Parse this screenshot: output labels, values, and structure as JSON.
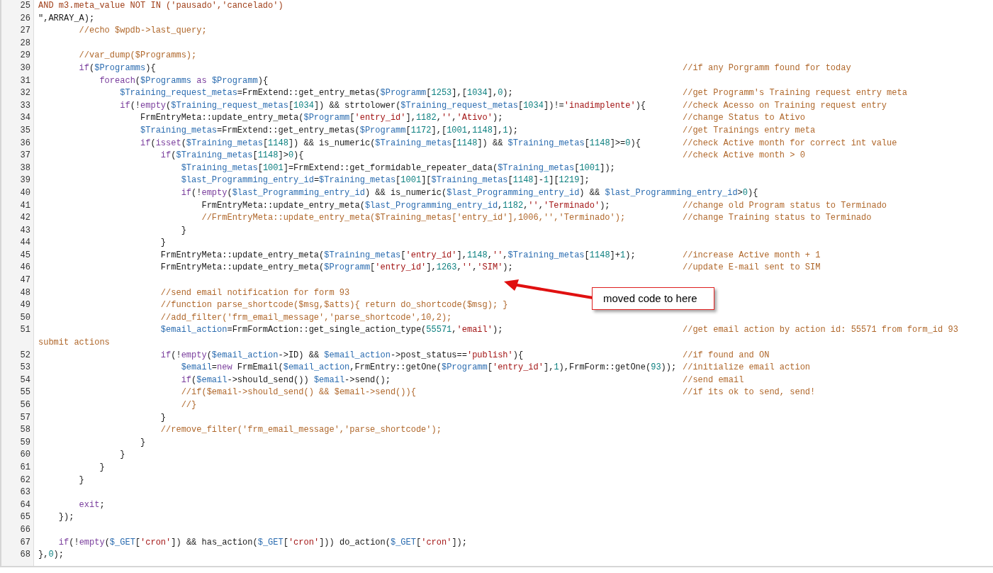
{
  "editor": {
    "lines": [
      {
        "number": "25",
        "kind": "string",
        "code": "AND m3.meta_value NOT IN ('pausado','cancelado')"
      },
      {
        "number": "26",
        "kind": "code",
        "code": "\",ARRAY_A);"
      },
      {
        "number": "27",
        "kind": "code",
        "code": "        //echo $wpdb->last_query;"
      },
      {
        "number": "28"
      },
      {
        "number": "29",
        "kind": "code",
        "code": "        //var_dump($Programms);"
      },
      {
        "number": "30",
        "kind": "code",
        "code": "        if($Programms){",
        "comment": "//if any Porgramm found for today"
      },
      {
        "number": "31",
        "kind": "code",
        "code": "            foreach($Programms as $Programm){"
      },
      {
        "number": "32",
        "kind": "code",
        "code": "                $Training_request_metas=FrmExtend::get_entry_metas($Programm[1253],[1034],0);",
        "comment": "//get Programm's Training request entry meta"
      },
      {
        "number": "33",
        "kind": "code",
        "code": "                if(!empty($Training_request_metas[1034]) && strtolower($Training_request_metas[1034])!='inadimplente'){",
        "comment": "//check Acesso on Training request entry"
      },
      {
        "number": "34",
        "kind": "code",
        "code": "                    FrmEntryMeta::update_entry_meta($Programm['entry_id'],1182,'','Ativo');",
        "comment": "//change Status to Ativo"
      },
      {
        "number": "35",
        "kind": "code",
        "code": "                    $Training_metas=FrmExtend::get_entry_metas($Programm[1172],[1001,1148],1);",
        "comment": "//get Trainings entry meta"
      },
      {
        "number": "36",
        "kind": "code",
        "code": "                    if(isset($Training_metas[1148]) && is_numeric($Training_metas[1148]) && $Training_metas[1148]>=0){",
        "comment": "//check Active month for correct int value"
      },
      {
        "number": "37",
        "kind": "code",
        "code": "                        if($Training_metas[1148]>0){",
        "comment": "//check Active month > 0"
      },
      {
        "number": "38",
        "kind": "code",
        "code": "                            $Training_metas[1001]=FrmExtend::get_formidable_repeater_data($Training_metas[1001]);"
      },
      {
        "number": "39",
        "kind": "code",
        "code": "                            $last_Programming_entry_id=$Training_metas[1001][$Training_metas[1148]-1][1219];"
      },
      {
        "number": "40",
        "kind": "code",
        "code": "                            if(!empty($last_Programming_entry_id) && is_numeric($last_Programming_entry_id) && $last_Programming_entry_id>0){"
      },
      {
        "number": "41",
        "kind": "code",
        "code": "                                FrmEntryMeta::update_entry_meta($last_Programming_entry_id,1182,'','Terminado');",
        "comment": "//change old Program status to Terminado"
      },
      {
        "number": "42",
        "kind": "code",
        "code": "                                //FrmEntryMeta::update_entry_meta($Training_metas['entry_id'],1006,'','Terminado');",
        "comment": "//change Training status to Terminado"
      },
      {
        "number": "43",
        "kind": "code",
        "code": "                            }"
      },
      {
        "number": "44",
        "kind": "code",
        "code": "                        }"
      },
      {
        "number": "45",
        "kind": "code",
        "code": "                        FrmEntryMeta::update_entry_meta($Training_metas['entry_id'],1148,'',$Training_metas[1148]+1);",
        "comment": "//increase Active month + 1"
      },
      {
        "number": "46",
        "kind": "code",
        "code": "                        FrmEntryMeta::update_entry_meta($Programm['entry_id'],1263,'','SIM');",
        "comment": "//update E-mail sent to SIM"
      },
      {
        "number": "47"
      },
      {
        "number": "48",
        "kind": "code",
        "code": "                        //send email notification for form 93"
      },
      {
        "number": "49",
        "kind": "code",
        "code": "                        //function parse_shortcode($msg,$atts){ return do_shortcode($msg); }"
      },
      {
        "number": "50",
        "kind": "code",
        "code": "                        //add_filter('frm_email_message','parse_shortcode',10,2);"
      },
      {
        "number": "51",
        "kind": "code",
        "code": "                        $email_action=FrmFormAction::get_single_action_type(55571,'email');",
        "comment": "//get email action by action id: 55571 from form_id 93",
        "comment_wrap": "submit actions"
      },
      {
        "number": "52",
        "kind": "code",
        "code": "                        if(!empty($email_action->ID) && $email_action->post_status=='publish'){",
        "comment": "//if found and ON"
      },
      {
        "number": "53",
        "kind": "code",
        "code": "                            $email=new FrmEmail($email_action,FrmEntry::getOne($Programm['entry_id'],1),FrmForm::getOne(93));",
        "comment": "//initialize email action"
      },
      {
        "number": "54",
        "kind": "code",
        "code": "                            if($email->should_send()) $email->send();",
        "comment": "//send email"
      },
      {
        "number": "55",
        "kind": "code",
        "code": "                            //if($email->should_send() && $email->send()){",
        "comment": "//if its ok to send, send!"
      },
      {
        "number": "56",
        "kind": "code",
        "code": "                            //}"
      },
      {
        "number": "57",
        "kind": "code",
        "code": "                        }"
      },
      {
        "number": "58",
        "kind": "code",
        "code": "                        //remove_filter('frm_email_message','parse_shortcode');"
      },
      {
        "number": "59",
        "kind": "code",
        "code": "                    }"
      },
      {
        "number": "60",
        "kind": "code",
        "code": "                }"
      },
      {
        "number": "61",
        "kind": "code",
        "code": "            }"
      },
      {
        "number": "62",
        "kind": "code",
        "code": "        }"
      },
      {
        "number": "63"
      },
      {
        "number": "64",
        "kind": "code",
        "code": "        exit;"
      },
      {
        "number": "65",
        "kind": "code",
        "code": "    });"
      },
      {
        "number": "66"
      },
      {
        "number": "67",
        "kind": "code",
        "code": "    if(!empty($_GET['cron']) && has_action($_GET['cron'])) do_action($_GET['cron']);"
      },
      {
        "number": "68",
        "kind": "code",
        "code": "},0);"
      }
    ]
  },
  "annotation": {
    "label": "moved code to here"
  }
}
